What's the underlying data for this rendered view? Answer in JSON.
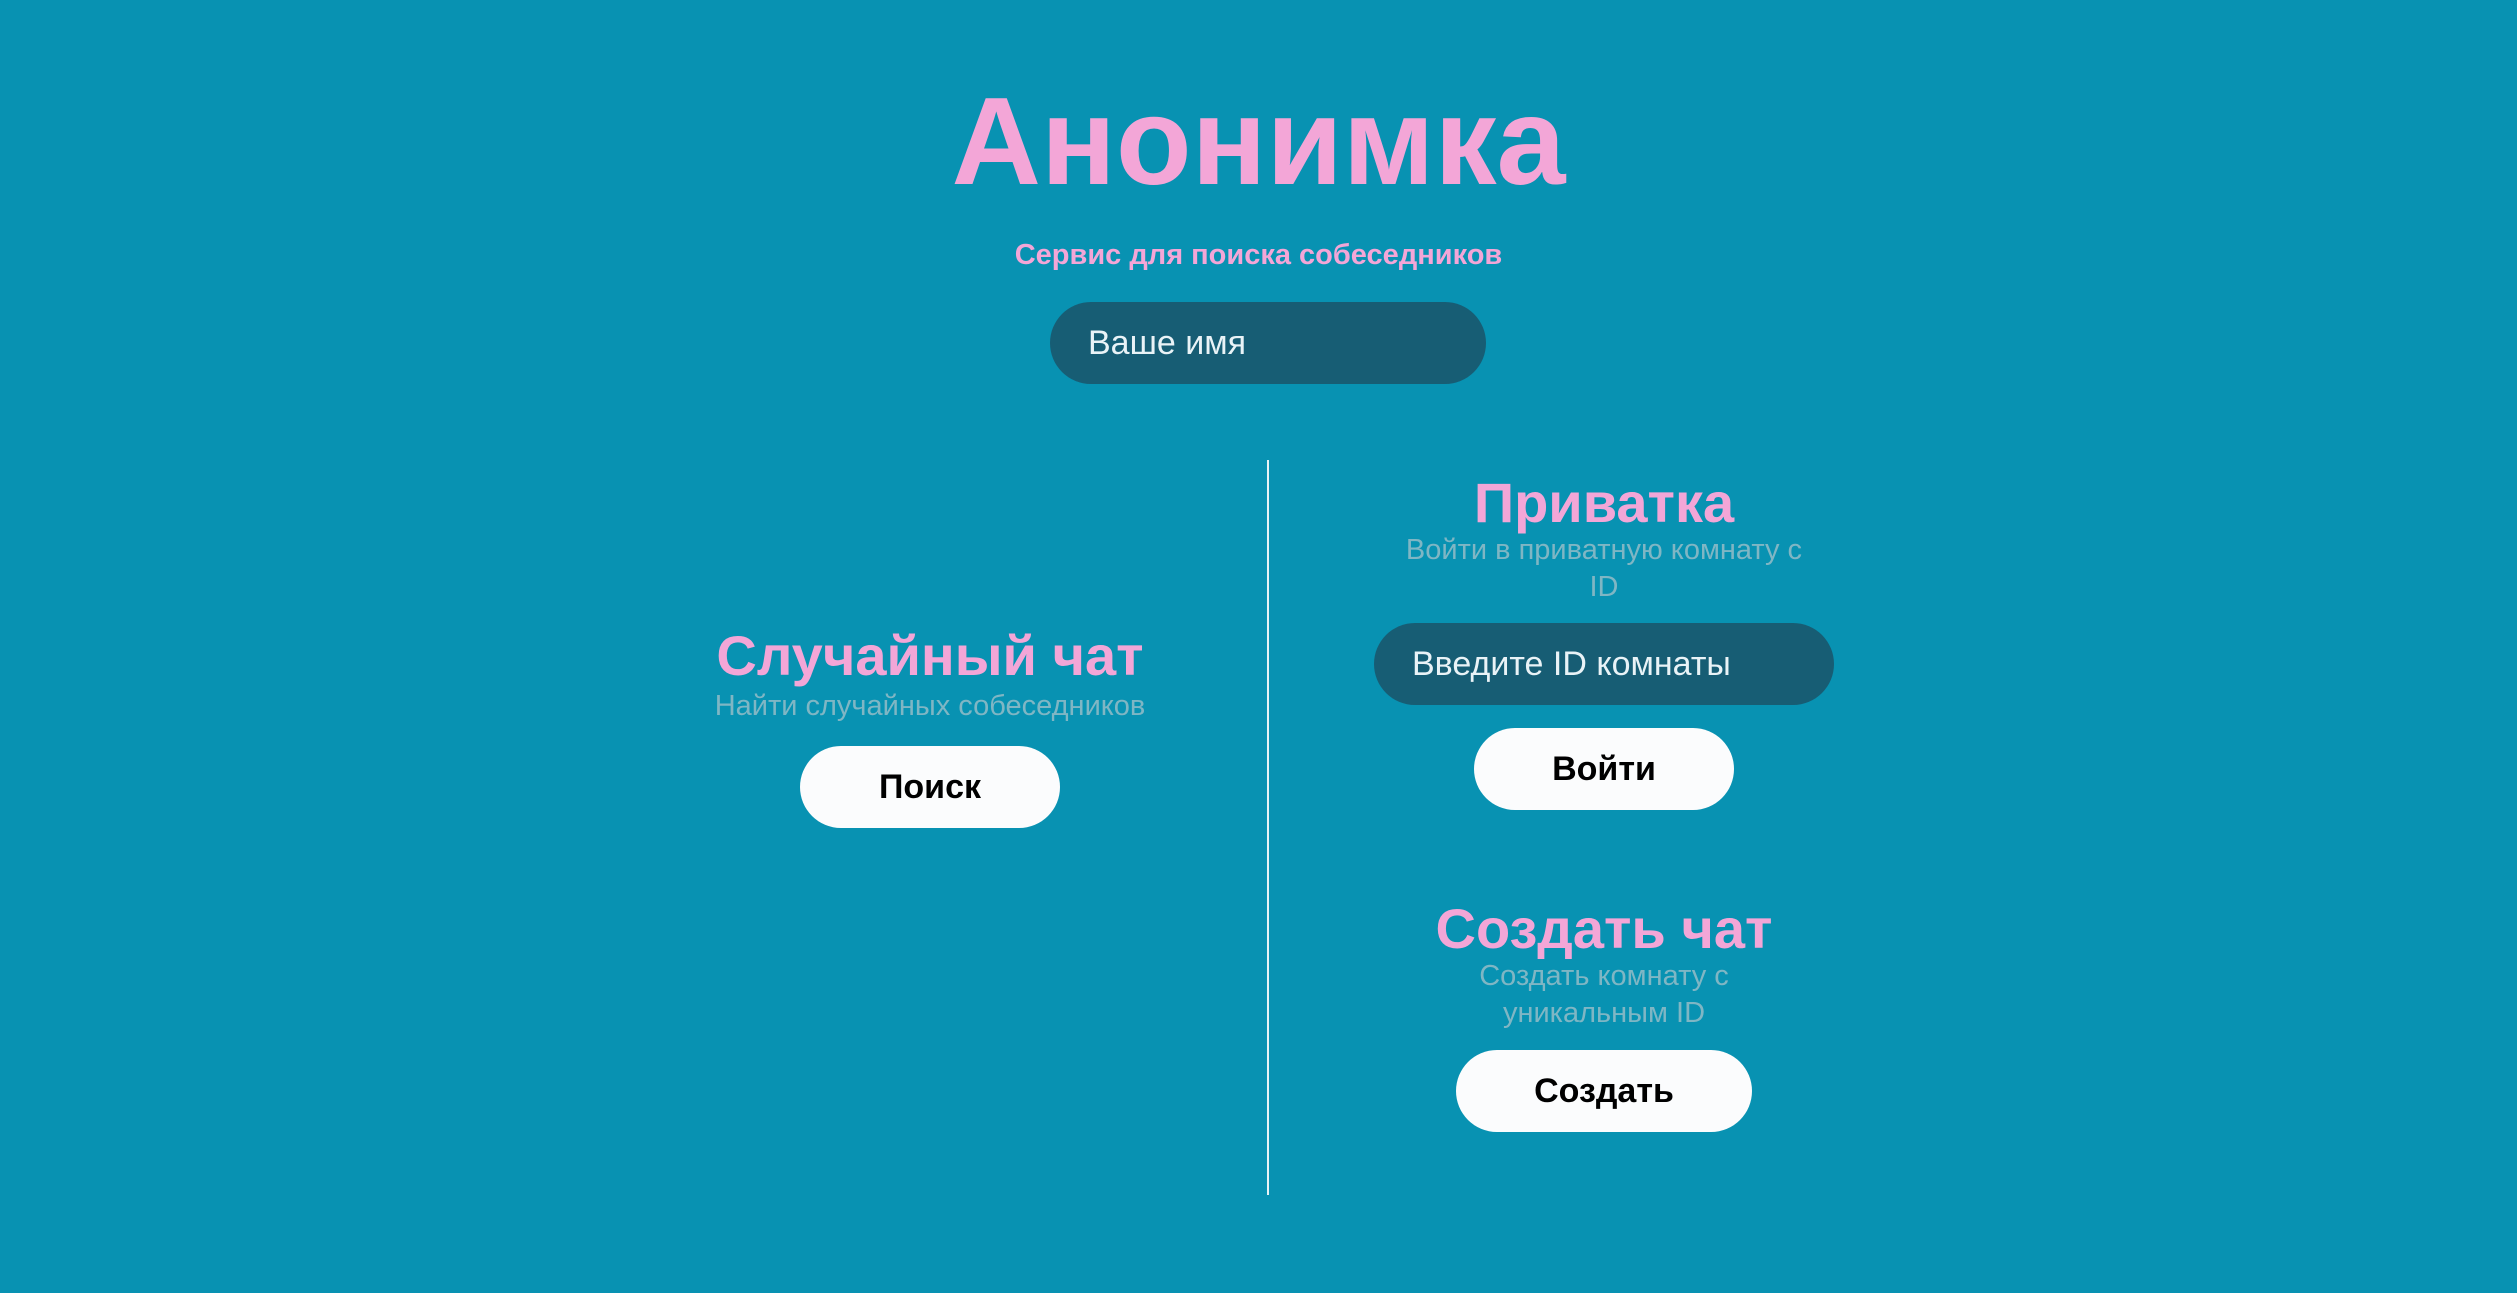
{
  "header": {
    "title": "Анонимка",
    "subtitle": "Сервис для поиска собеседников"
  },
  "name_input": {
    "placeholder": "Ваше имя"
  },
  "random_chat": {
    "title": "Случайный чат",
    "description": "Найти случайных собеседников",
    "button_label": "Поиск"
  },
  "private_room": {
    "title": "Приватка",
    "description": "Войти в приватную комнату с ID",
    "input_placeholder": "Введите ID комнаты",
    "button_label": "Войти"
  },
  "create_chat": {
    "title": "Создать чат",
    "description": "Создать комнату с уникальным ID",
    "button_label": "Создать"
  },
  "colors": {
    "background": "#0892b2",
    "accent_pink": "#f3a6d7",
    "input_background": "#175d74",
    "muted_text": "#7fb6c4",
    "button_background": "#fbfcfd"
  }
}
